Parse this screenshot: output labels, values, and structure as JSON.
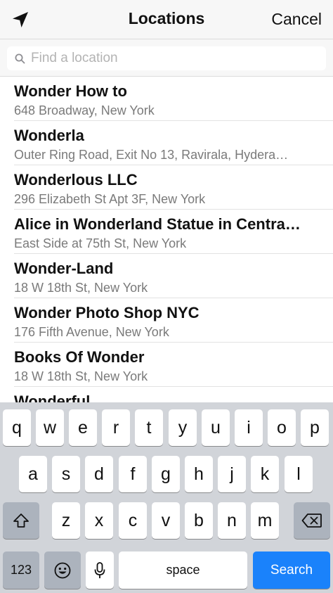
{
  "header": {
    "title": "Locations",
    "cancel_label": "Cancel",
    "nav_icon": "location-arrow-icon"
  },
  "search": {
    "placeholder": "Find a location",
    "value": "",
    "icon": "search-icon"
  },
  "locations": [
    {
      "name": "Wonder How to",
      "address": "648 Broadway, New York"
    },
    {
      "name": "Wonderla",
      "address": "Outer Ring Road, Exit No 13, Ravirala, Hydera…"
    },
    {
      "name": "Wonderlous LLC",
      "address": "296 Elizabeth St Apt 3F, New York"
    },
    {
      "name": "Alice in Wonderland Statue in Centra…",
      "address": "East Side at 75th St, New York"
    },
    {
      "name": "Wonder-Land",
      "address": "18 W 18th St, New York"
    },
    {
      "name": "Wonder Photo Shop NYC",
      "address": "176 Fifth Avenue, New York"
    },
    {
      "name": "Books Of Wonder",
      "address": "18 W 18th St, New York"
    },
    {
      "name": "Wonderful",
      "address": ""
    }
  ],
  "keyboard": {
    "row1": [
      "q",
      "w",
      "e",
      "r",
      "t",
      "y",
      "u",
      "i",
      "o",
      "p"
    ],
    "row2": [
      "a",
      "s",
      "d",
      "f",
      "g",
      "h",
      "j",
      "k",
      "l"
    ],
    "row3": [
      "z",
      "x",
      "c",
      "v",
      "b",
      "n",
      "m"
    ],
    "numbers_label": "123",
    "space_label": "space",
    "search_label": "Search",
    "shift_icon": "shift-icon",
    "delete_icon": "delete-icon",
    "emoji_icon": "emoji-icon",
    "mic_icon": "microphone-icon",
    "accent_color": "#1a82fb"
  }
}
